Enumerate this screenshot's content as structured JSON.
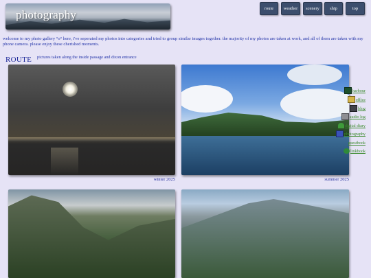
{
  "header": {
    "title": "photography"
  },
  "nav": [
    {
      "label": "route"
    },
    {
      "label": "weather"
    },
    {
      "label": "scenery"
    },
    {
      "label": "ship"
    },
    {
      "label": "top"
    }
  ],
  "intro": {
    "text": "welcome to my photo gallery °o° here, i've seperated my photos into categories and tried to group similar images together. the majority of my photos are taken at work, and all of them are taken with my phone camera. please enjoy these cherished moments."
  },
  "section": {
    "name": "ROUTE",
    "description": "pictures taken along the inside passage and dixon entrance"
  },
  "photos": [
    {
      "caption": "winter 2025"
    },
    {
      "caption": "summer 2025"
    },
    {
      "caption": ""
    },
    {
      "caption": ""
    }
  ],
  "sidebar": [
    {
      "label": "harbour",
      "icon": "computer-icon"
    },
    {
      "label": "office",
      "icon": "folder-icon"
    },
    {
      "label": "blog",
      "icon": "printer-icon"
    },
    {
      "label": "audio log",
      "icon": "cassette-icon"
    },
    {
      "label": "digital diary",
      "icon": "plant-icon"
    },
    {
      "label": "photography",
      "icon": "photo-icon"
    },
    {
      "label": "guestbook",
      "icon": "book-icon"
    },
    {
      "label": "linkbook",
      "icon": "globe-icon"
    }
  ]
}
